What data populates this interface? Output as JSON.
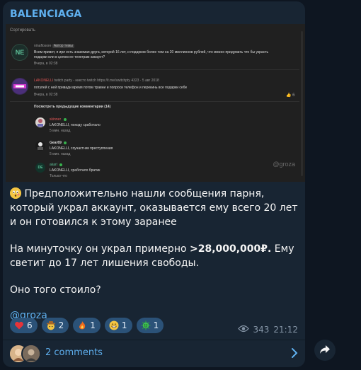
{
  "post": {
    "channel_name": "BALENCIAGA",
    "screenshot": {
      "sort_label": "Сортировать",
      "comment1": {
        "avatar_text": "NE",
        "author": "ninaflosore",
        "badge": "Автор темы",
        "line1": "Всем привет, я ирл есть знакомая друга, которой 16 лет, и подарков более чем на 20 миллионов рублей, что можно придумать что бы украсть",
        "line2": "подарки или в целом ее телеграм аккаунт?",
        "time": "Вчера, в 02:38"
      },
      "comment2": {
        "author": "LAKONELLI",
        "author_extra": "twitch party - никсто twitch https://t.me/switchpty",
        "stats": "4323 · 5 авг 2018",
        "text": "потупей с ней привади время потом травни и попроси телефон и перекинь все подарки себе",
        "time": "Вчера, в 02:38",
        "likes": "6"
      },
      "prev_comments_label": "Посмотреть предыдущие комментарии (14)",
      "replies": [
        {
          "author": "skinner",
          "text": "LAKONELLI, походу сработало",
          "time": "5 мин. назад"
        },
        {
          "author": "Gear69",
          "text": "LAKONELLI, соучастник преступления",
          "time": "5 мин. назад"
        },
        {
          "author": "akarl",
          "avatar_text": "DE",
          "text": "LAKONELLI, сработало братик",
          "time": "Только что"
        }
      ],
      "watermark": "@groza"
    },
    "message": {
      "p1": "Предположительно нашли сообщения парня, который украл аккаунт, оказывается ему всего 20 лет и он готовился к этому заранее",
      "p2_before": "На минуточку он украл примерно ",
      "p2_bold": ">28,000,000₽.",
      "p2_after": " Ему светит до 17 лет лишения свободы.",
      "p3": "Оно того стоило?",
      "mention": "@groza"
    },
    "reactions": [
      {
        "emoji": "heart-icon",
        "count": "6"
      },
      {
        "emoji": "cowboy-icon",
        "count": "2"
      },
      {
        "emoji": "fire-icon",
        "count": "1"
      },
      {
        "emoji": "grin-icon",
        "count": "1"
      },
      {
        "emoji": "virus-icon",
        "count": "1"
      }
    ],
    "views": "343",
    "time": "21:12",
    "comments_label": "2 comments"
  },
  "colors": {
    "accent": "#5fb0ef",
    "bubble": "#182533",
    "reaction_bg": "#2b5278",
    "background": "#0e1621"
  }
}
